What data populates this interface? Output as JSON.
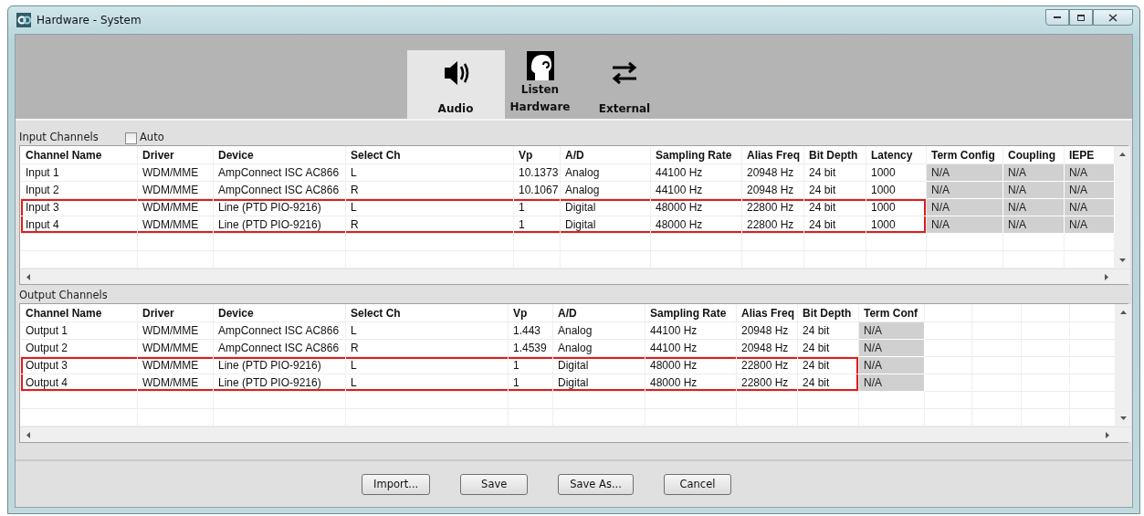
{
  "window": {
    "title": "Hardware - System"
  },
  "tabs": [
    {
      "label": "Audio",
      "kind": "audio",
      "selected": true
    },
    {
      "label": "Listen Hardware",
      "kind": "listen",
      "selected": false
    },
    {
      "label": "External",
      "kind": "external",
      "selected": false
    }
  ],
  "input_channels": {
    "title": "Input Channels",
    "auto": {
      "label": "Auto",
      "checked": false
    },
    "columns": [
      {
        "label": "Channel Name",
        "readonly": false
      },
      {
        "label": "Driver",
        "readonly": false
      },
      {
        "label": "Device",
        "readonly": false
      },
      {
        "label": "Select Ch",
        "readonly": false
      },
      {
        "label": "Vp",
        "readonly": false
      },
      {
        "label": "A/D",
        "readonly": false
      },
      {
        "label": "Sampling Rate",
        "readonly": false
      },
      {
        "label": "Alias Freq",
        "readonly": false
      },
      {
        "label": "Bit Depth",
        "readonly": false
      },
      {
        "label": "Latency",
        "readonly": false
      },
      {
        "label": "Term Config",
        "readonly": true
      },
      {
        "label": "Coupling",
        "readonly": true
      },
      {
        "label": "IEPE",
        "readonly": true
      }
    ],
    "rows": [
      {
        "highlighted": false,
        "cells": [
          "Input 1",
          "WDM/MME",
          "AmpConnect ISC AC866",
          "L",
          "10.1373",
          "Analog",
          "44100 Hz",
          "20948 Hz",
          "24 bit",
          "1000",
          "N/A",
          "N/A",
          "N/A"
        ]
      },
      {
        "highlighted": false,
        "cells": [
          "Input 2",
          "WDM/MME",
          "AmpConnect ISC AC866",
          "R",
          "10.1067",
          "Analog",
          "44100 Hz",
          "20948 Hz",
          "24 bit",
          "1000",
          "N/A",
          "N/A",
          "N/A"
        ]
      },
      {
        "highlighted": true,
        "cells": [
          "Input 3",
          "WDM/MME",
          "Line (PTD PIO-9216)",
          "L",
          "1",
          "Digital",
          "48000 Hz",
          "22800 Hz",
          "24 bit",
          "1000",
          "N/A",
          "N/A",
          "N/A"
        ]
      },
      {
        "highlighted": true,
        "cells": [
          "Input 4",
          "WDM/MME",
          "Line (PTD PIO-9216)",
          "R",
          "1",
          "Digital",
          "48000 Hz",
          "22800 Hz",
          "24 bit",
          "1000",
          "N/A",
          "N/A",
          "N/A"
        ]
      }
    ]
  },
  "output_channels": {
    "title": "Output Channels",
    "columns": [
      {
        "label": "Channel Name",
        "readonly": false
      },
      {
        "label": "Driver",
        "readonly": false
      },
      {
        "label": "Device",
        "readonly": false
      },
      {
        "label": "Select Ch",
        "readonly": false
      },
      {
        "label": "Vp",
        "readonly": false
      },
      {
        "label": "A/D",
        "readonly": false
      },
      {
        "label": "Sampling Rate",
        "readonly": false
      },
      {
        "label": "Alias Freq",
        "readonly": false
      },
      {
        "label": "Bit Depth",
        "readonly": false
      },
      {
        "label": "Term Conf",
        "readonly": true
      }
    ],
    "rows": [
      {
        "highlighted": false,
        "cells": [
          "Output 1",
          "WDM/MME",
          "AmpConnect ISC AC866",
          "L",
          "1.443",
          "Analog",
          "44100 Hz",
          "20948 Hz",
          "24 bit",
          "N/A"
        ]
      },
      {
        "highlighted": false,
        "cells": [
          "Output 2",
          "WDM/MME",
          "AmpConnect ISC AC866",
          "R",
          "1.4539",
          "Analog",
          "44100 Hz",
          "20948 Hz",
          "24 bit",
          "N/A"
        ]
      },
      {
        "highlighted": true,
        "cells": [
          "Output 3",
          "WDM/MME",
          "Line (PTD PIO-9216)",
          "L",
          "1",
          "Digital",
          "48000 Hz",
          "22800 Hz",
          "24 bit",
          "N/A"
        ]
      },
      {
        "highlighted": true,
        "cells": [
          "Output 4",
          "WDM/MME",
          "Line (PTD PIO-9216)",
          "L",
          "1",
          "Digital",
          "48000 Hz",
          "22800 Hz",
          "24 bit",
          "N/A"
        ]
      }
    ]
  },
  "buttons": [
    "Import...",
    "Save",
    "Save As...",
    "Cancel"
  ]
}
